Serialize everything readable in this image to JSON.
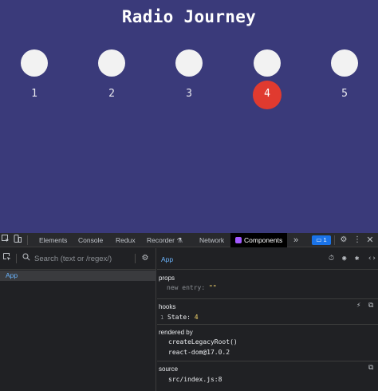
{
  "app": {
    "title": "Radio Journey",
    "radios": [
      {
        "label": "1",
        "selected": false
      },
      {
        "label": "2",
        "selected": false
      },
      {
        "label": "3",
        "selected": false
      },
      {
        "label": "4",
        "selected": true
      },
      {
        "label": "5",
        "selected": false
      }
    ],
    "colors": {
      "background": "#3a3a7a",
      "radio": "#f2f2f2",
      "selected": "#e03a2f"
    }
  },
  "devtools": {
    "tabs": [
      "Elements",
      "Console",
      "Redux",
      "Recorder",
      "Network",
      "Components"
    ],
    "active_tab": "Components",
    "overflow_icon": "»",
    "message_count": "1",
    "search_placeholder": "Search (text or /regex/)",
    "tree": [
      "App"
    ],
    "inspector": {
      "component": "App",
      "props_label": "props",
      "prop_key": "new entry:",
      "prop_value": "\"\"",
      "hooks_label": "hooks",
      "hook_index": "1",
      "hook_name": "State:",
      "hook_value": "4",
      "rendered_by_label": "rendered by",
      "rendered_by": [
        "createLegacyRoot()",
        "react-dom@17.0.2"
      ],
      "source_label": "source",
      "source_value": "src/index.js:8"
    }
  }
}
